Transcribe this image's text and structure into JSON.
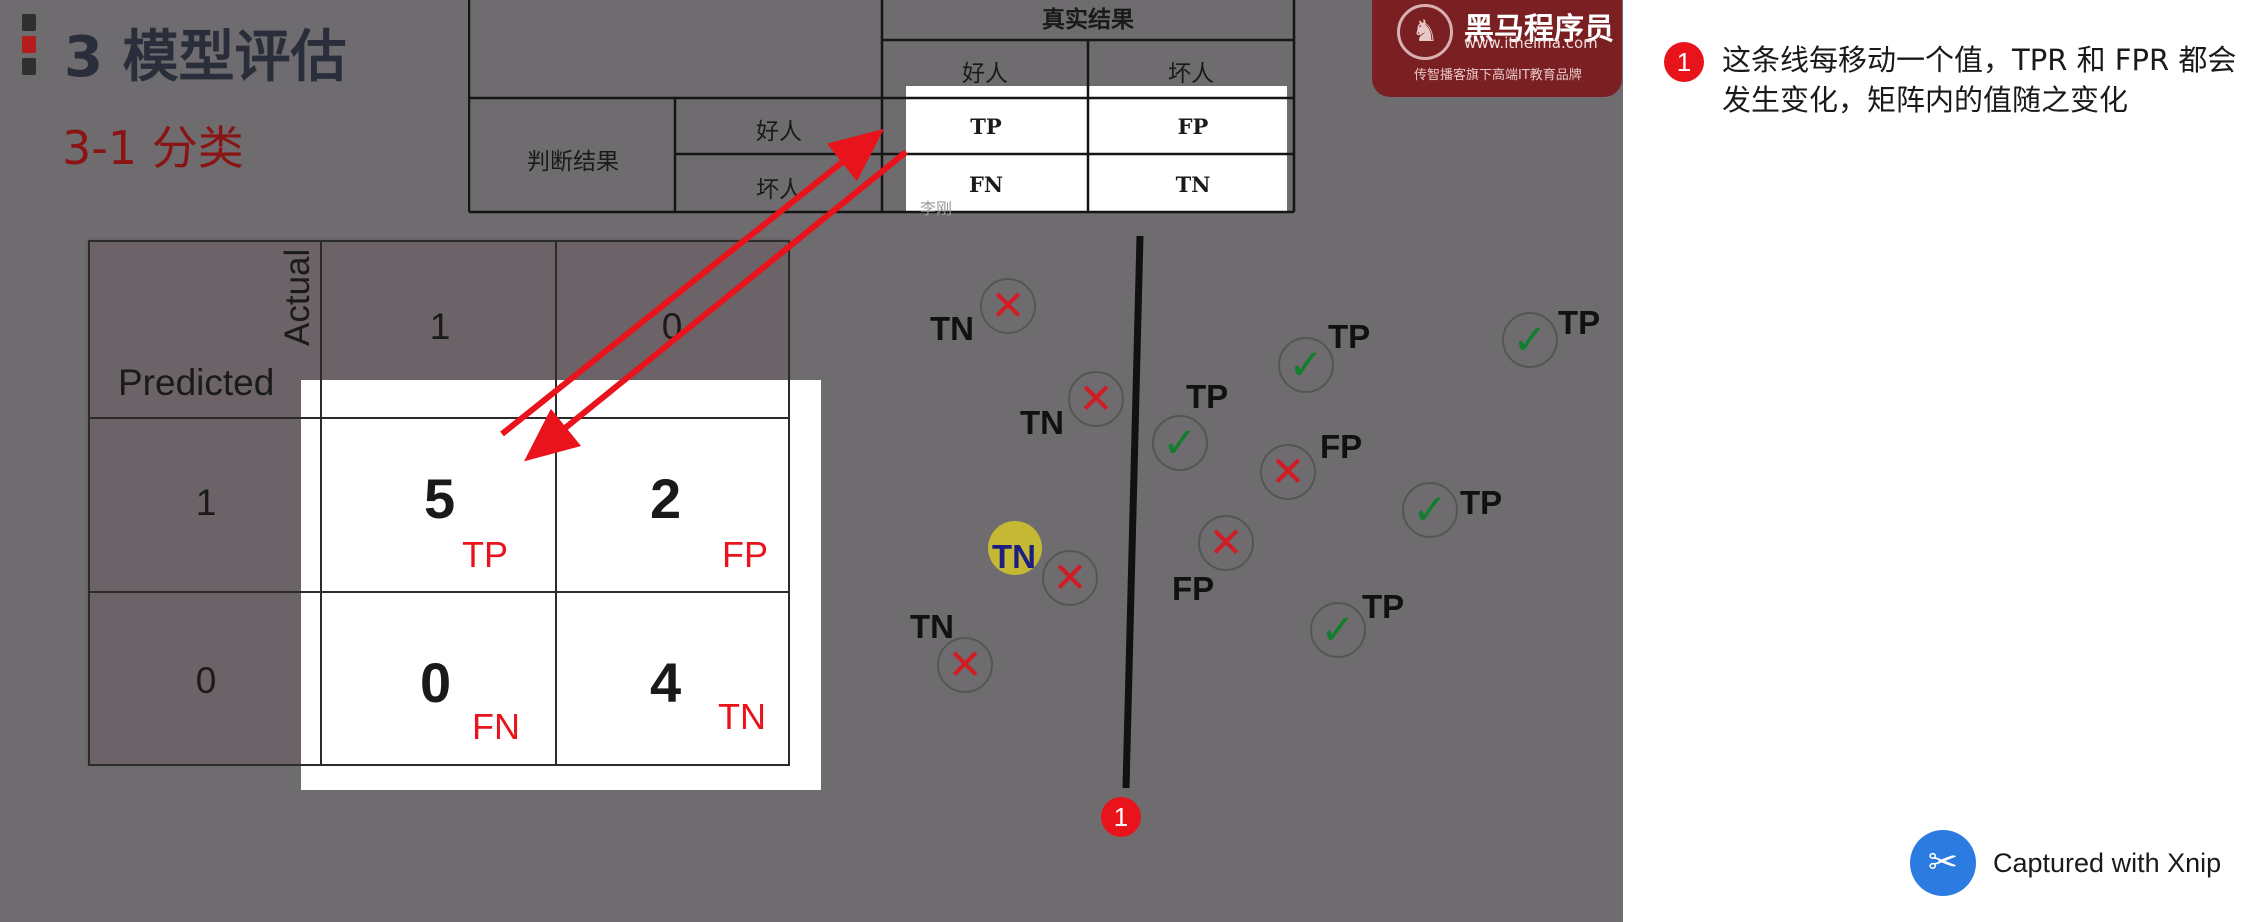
{
  "slide": {
    "title": "3 模型评估",
    "subtitle": "3-1 分类"
  },
  "logo": {
    "name": "黑马程序员",
    "url": "www.itheima.com",
    "slogan": "传智播客旗下高端IT教育品牌"
  },
  "ref_table": {
    "header": "真实结果",
    "col_good": "好人",
    "col_bad": "坏人",
    "row_group": "判断结果",
    "row_good": "好人",
    "row_bad": "坏人",
    "cell_tp": "TP",
    "cell_fp": "FP",
    "cell_fn": "FN",
    "cell_tn": "TN",
    "faint_text": "李刚"
  },
  "confusion_matrix": {
    "actual_label": "Actual",
    "predicted_label": "Predicted",
    "col_1": "1",
    "col_0": "0",
    "row_1": "1",
    "row_0": "0",
    "tp_value": "5",
    "tp_label": "TP",
    "fp_value": "2",
    "fp_label": "FP",
    "fn_value": "0",
    "fn_label": "FN",
    "tn_value": "4",
    "tn_label": "TN"
  },
  "points": {
    "tn_1": "TN",
    "tn_2": "TN",
    "tn_3": "TN",
    "tn_4": "TN",
    "tp_1": "TP",
    "tp_2": "TP",
    "tp_3": "TP",
    "tp_4": "TP",
    "tp_5": "TP",
    "fp_1": "FP",
    "fp_2": "FP"
  },
  "annotation": {
    "badge": "1",
    "note": "这条线每移动一个值，TPR 和 FPR 都会发生变化，矩阵内的值随之变化"
  },
  "watermark": {
    "text": "Captured with Xnip"
  },
  "colors": {
    "accent_red": "#e8131b",
    "cross_red": "#d01c24",
    "check_green": "#137d2e",
    "slide_overlay": "#6e6c6e"
  }
}
